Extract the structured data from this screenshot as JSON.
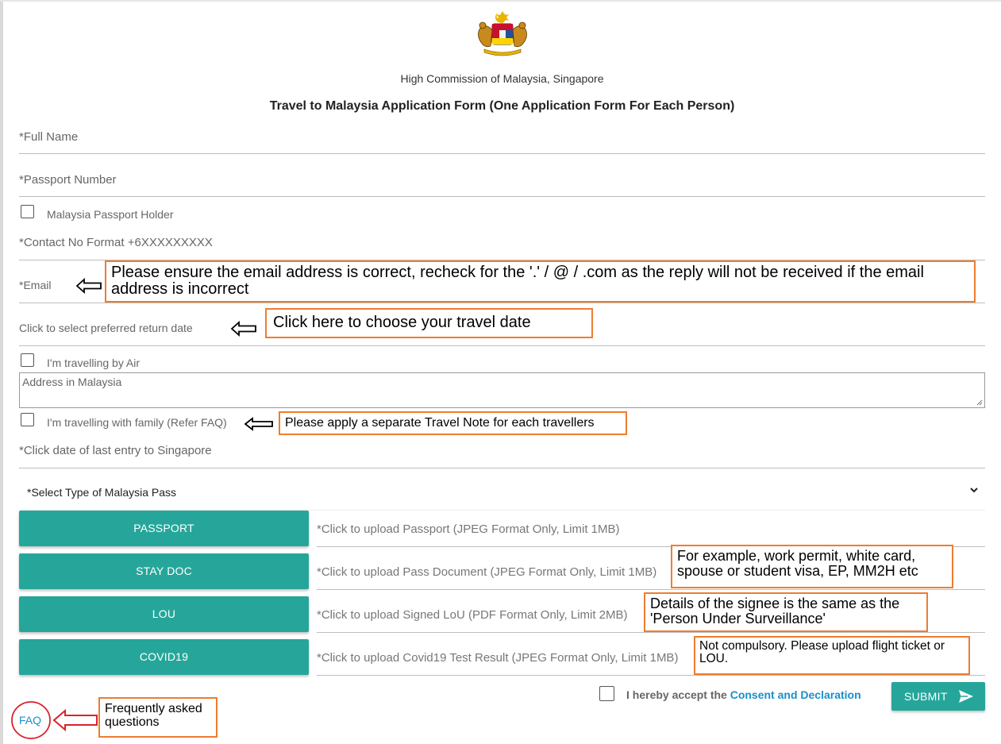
{
  "header": {
    "organization": "High Commission of Malaysia, Singapore",
    "title": "Travel to Malaysia Application Form (One Application Form For Each Person)"
  },
  "form": {
    "full_name": "*Full Name",
    "passport_number": "*Passport Number",
    "malaysia_passport_holder": "Malaysia Passport Holder",
    "contact_no": "*Contact No Format +6XXXXXXXXX",
    "email": "*Email",
    "return_date": "Click to select preferred return date",
    "travel_by_air": "I'm travelling by Air",
    "address_placeholder": "Address in Malaysia",
    "travel_with_family": "I'm travelling with family (Refer FAQ)",
    "last_entry": "*Click date of last entry to Singapore",
    "pass_type_select": "*Select Type of Malaysia Pass"
  },
  "uploads": [
    {
      "button": "PASSPORT",
      "hint": "*Click to upload Passport (JPEG Format Only, Limit 1MB)"
    },
    {
      "button": "STAY DOC",
      "hint": "*Click to upload Pass Document (JPEG Format Only, Limit 1MB)"
    },
    {
      "button": "LOU",
      "hint": "*Click to upload Signed LoU (PDF Format Only, Limit 2MB)"
    },
    {
      "button": "COVID19",
      "hint": "*Click to upload Covid19 Test Result (JPEG Format Only, Limit 1MB)"
    }
  ],
  "footer": {
    "consent_prefix": "I hereby accept the",
    "consent_link": "Consent and Declaration",
    "submit": "SUBMIT",
    "faq": "FAQ"
  },
  "annotations": {
    "email_note": "Please ensure the email address is correct, recheck for the '.' / @ / .com as the reply will not be received if the email address is incorrect",
    "date_note": "Click here to choose your travel date",
    "family_note": "Please apply a separate Travel Note for each travellers",
    "staydoc_note": "For example, work permit, white card, spouse or student visa, EP, MM2H etc",
    "lou_note": "Details of the signee is the same as the 'Person Under Surveillance'",
    "covid_note": "Not compulsory. Please upload flight ticket or LOU.",
    "faq_note": "Frequently asked questions"
  },
  "colors": {
    "teal": "#26a69a",
    "note_border": "#ed7d31",
    "link": "#1a8fc9",
    "faq_arrow": "#d9232d"
  }
}
